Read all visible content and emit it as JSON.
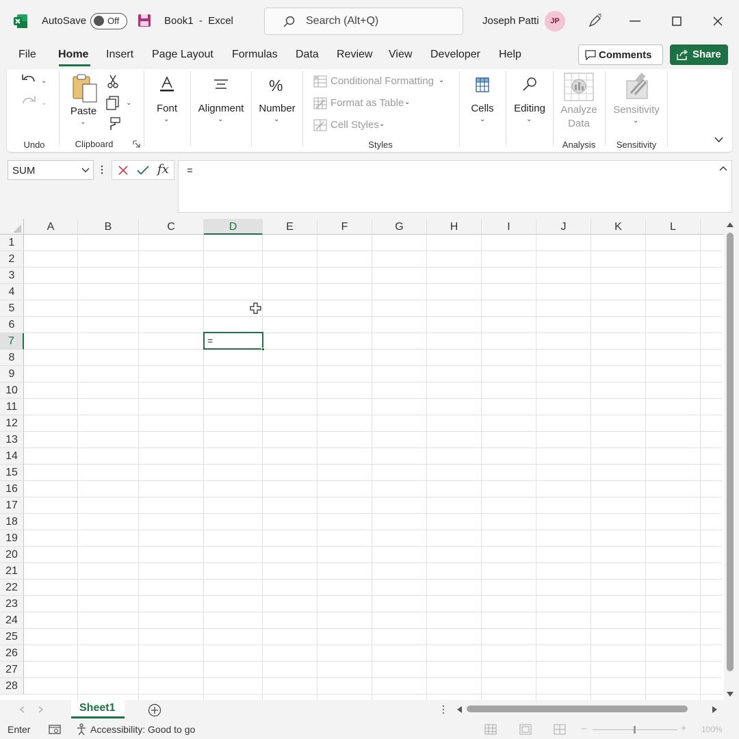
{
  "titlebar": {
    "autosave_label": "AutoSave",
    "autosave_state": "Off",
    "document_title": "Book1  -  Excel",
    "search_placeholder": "Search (Alt+Q)",
    "user_name": "Joseph Patti",
    "user_initials": "JP"
  },
  "menu": {
    "tabs": [
      "File",
      "Home",
      "Insert",
      "Page Layout",
      "Formulas",
      "Data",
      "Review",
      "View",
      "Developer",
      "Help"
    ],
    "active_tab": "Home",
    "comments_label": "Comments",
    "share_label": "Share"
  },
  "ribbon": {
    "groups": {
      "undo": "Undo",
      "clipboard": "Clipboard",
      "styles": "Styles",
      "analysis": "Analysis",
      "sensitivity": "Sensitivity"
    },
    "paste_label": "Paste",
    "font_label": "Font",
    "alignment_label": "Alignment",
    "number_label": "Number",
    "conditional_formatting_label": "Conditional Formatting",
    "format_as_table_label": "Format as Table",
    "cell_styles_label": "Cell Styles",
    "cells_label": "Cells",
    "editing_label": "Editing",
    "analyze_data_label_1": "Analyze",
    "analyze_data_label_2": "Data",
    "sensitivity_label": "Sensitivity"
  },
  "formula_bar": {
    "name_box": "SUM",
    "formula": "="
  },
  "grid": {
    "columns": [
      "A",
      "B",
      "C",
      "D",
      "E",
      "F",
      "G",
      "H",
      "I",
      "J",
      "K",
      "L"
    ],
    "rows": [
      "1",
      "2",
      "3",
      "4",
      "5",
      "6",
      "7",
      "8",
      "9",
      "10",
      "11",
      "12",
      "13",
      "14",
      "15",
      "16",
      "17",
      "18",
      "19",
      "20",
      "21",
      "22",
      "23",
      "24",
      "25",
      "26",
      "27",
      "28"
    ],
    "selected_column": "D",
    "selected_row": "7",
    "active_cell_value": "="
  },
  "sheets": {
    "tabs": [
      "Sheet1"
    ]
  },
  "statusbar": {
    "mode": "Enter",
    "accessibility": "Accessibility: Good to go",
    "zoom": "100%"
  },
  "colors": {
    "accent": "#1e7145",
    "excel_icon": "#107c41",
    "avatar_bg": "#f2c4d4"
  }
}
